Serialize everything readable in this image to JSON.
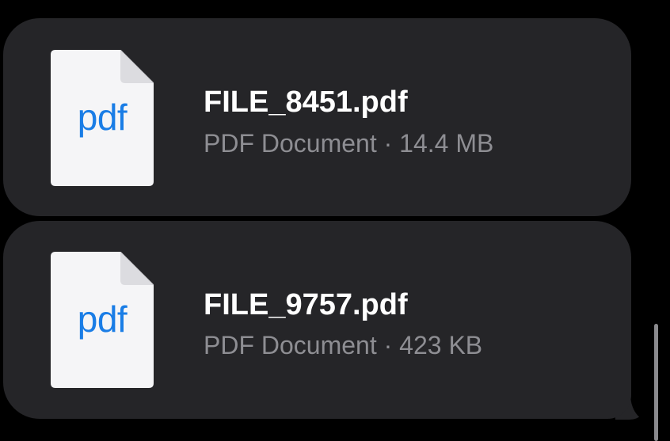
{
  "attachments": [
    {
      "icon_label": "pdf",
      "icon": "pdf-document-icon",
      "file_name": "FILE_8451.pdf",
      "file_type": "PDF Document",
      "separator": "·",
      "file_size": "14.4 MB",
      "meta": "PDF Document · 14.4 MB"
    },
    {
      "icon_label": "pdf",
      "icon": "pdf-document-icon",
      "file_name": "FILE_9757.pdf",
      "file_type": "PDF Document",
      "separator": "·",
      "file_size": "423 KB",
      "meta": "PDF Document · 423 KB"
    }
  ],
  "colors": {
    "background": "#000000",
    "bubble": "#252528",
    "icon_accent": "#1a7de6",
    "title": "#ffffff",
    "secondary": "#8e8e93"
  }
}
